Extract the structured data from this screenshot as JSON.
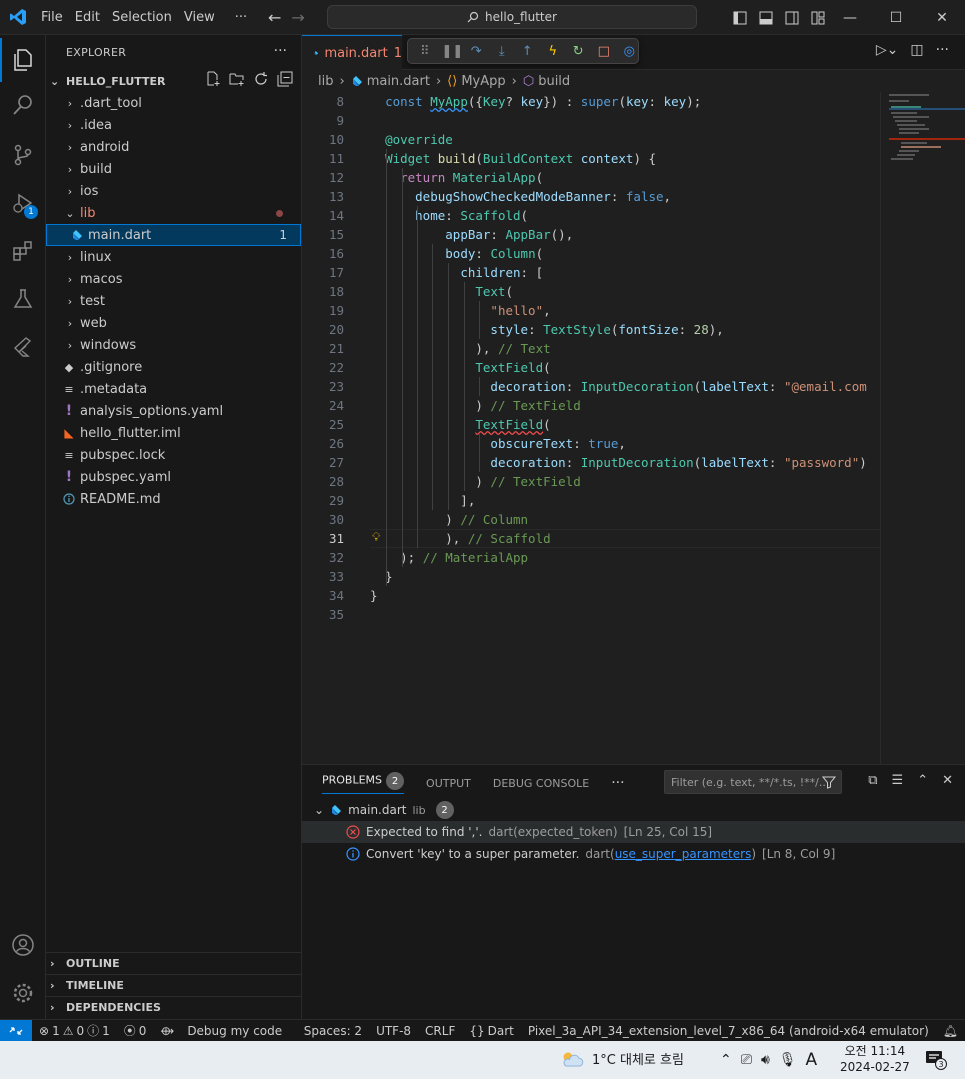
{
  "menu": [
    "File",
    "Edit",
    "Selection",
    "View",
    "···"
  ],
  "search": {
    "text": "hello_flutter"
  },
  "window_controls": [
    "minimize",
    "maximize",
    "close"
  ],
  "activity_bar": {
    "items": [
      "explorer-icon",
      "search-icon",
      "source-control-icon",
      "run-debug-icon",
      "extensions-icon",
      "testing-icon",
      "flutter-icon"
    ],
    "debug_badge": "1",
    "bottom": [
      "account-icon",
      "manage-gear-icon"
    ]
  },
  "explorer": {
    "title": "EXPLORER",
    "more": "···",
    "project": "HELLO_FLUTTER",
    "items": [
      {
        "label": ".dart_tool",
        "type": "folder"
      },
      {
        "label": ".idea",
        "type": "folder"
      },
      {
        "label": "android",
        "type": "folder"
      },
      {
        "label": "build",
        "type": "folder"
      },
      {
        "label": "ios",
        "type": "folder"
      },
      {
        "label": "lib",
        "type": "folder-open"
      },
      {
        "label": "main.dart",
        "type": "dart",
        "count": "1"
      },
      {
        "label": "linux",
        "type": "folder"
      },
      {
        "label": "macos",
        "type": "folder"
      },
      {
        "label": "test",
        "type": "folder"
      },
      {
        "label": "web",
        "type": "folder"
      },
      {
        "label": "windows",
        "type": "folder"
      },
      {
        "label": ".gitignore",
        "type": "file"
      },
      {
        "label": ".metadata",
        "type": "file"
      },
      {
        "label": "analysis_options.yaml",
        "type": "yaml"
      },
      {
        "label": "hello_flutter.iml",
        "type": "iml"
      },
      {
        "label": "pubspec.lock",
        "type": "lock"
      },
      {
        "label": "pubspec.yaml",
        "type": "yaml"
      },
      {
        "label": "README.md",
        "type": "info"
      }
    ],
    "sections": [
      "OUTLINE",
      "TIMELINE",
      "DEPENDENCIES"
    ]
  },
  "editor": {
    "tab": {
      "label": "main.dart",
      "count": "1"
    },
    "breadcrumb": [
      "lib",
      "main.dart",
      "MyApp",
      "build"
    ],
    "current_line": 31,
    "lines": [
      {
        "n": "8",
        "code": "  const MyApp({Key? key}) : super(key: key);"
      },
      {
        "n": "9",
        "code": ""
      },
      {
        "n": "10",
        "code": "  @override"
      },
      {
        "n": "11",
        "code": "  Widget build(BuildContext context) {"
      },
      {
        "n": "12",
        "code": "    return MaterialApp("
      },
      {
        "n": "13",
        "code": "      debugShowCheckedModeBanner: false,"
      },
      {
        "n": "14",
        "code": "      home: Scaffold("
      },
      {
        "n": "15",
        "code": "          appBar: AppBar(),"
      },
      {
        "n": "16",
        "code": "          body: Column("
      },
      {
        "n": "17",
        "code": "            children: ["
      },
      {
        "n": "18",
        "code": "              Text("
      },
      {
        "n": "19",
        "code": "                \"hello\","
      },
      {
        "n": "20",
        "code": "                style: TextStyle(fontSize: 28),"
      },
      {
        "n": "21",
        "code": "              ), // Text"
      },
      {
        "n": "22",
        "code": "              TextField("
      },
      {
        "n": "23",
        "code": "                decoration: InputDecoration(labelText: \"@email.com"
      },
      {
        "n": "24",
        "code": "              ) // TextField"
      },
      {
        "n": "25",
        "code": "              TextField("
      },
      {
        "n": "26",
        "code": "                obscureText: true,"
      },
      {
        "n": "27",
        "code": "                decoration: InputDecoration(labelText: \"password\")"
      },
      {
        "n": "28",
        "code": "              ) // TextField"
      },
      {
        "n": "29",
        "code": "            ],"
      },
      {
        "n": "30",
        "code": "          ) // Column"
      },
      {
        "n": "31",
        "code": "          ), // Scaffold"
      },
      {
        "n": "32",
        "code": "    ); // MaterialApp"
      },
      {
        "n": "33",
        "code": "  }"
      },
      {
        "n": "34",
        "code": "}"
      },
      {
        "n": "35",
        "code": ""
      }
    ]
  },
  "panel": {
    "tabs": [
      "PROBLEMS",
      "OUTPUT",
      "DEBUG CONSOLE",
      "···"
    ],
    "problems_count": "2",
    "filter_placeholder": "Filter (e.g. text, **/*.ts, !**/...",
    "file": {
      "name": "main.dart",
      "dir": "lib",
      "count": "2"
    },
    "problems": [
      {
        "severity": "error",
        "message": "Expected to find ','.",
        "source": "dart(expected_token)",
        "location": "[Ln 25, Col 15]"
      },
      {
        "severity": "info",
        "message": "Convert 'key' to a super parameter.",
        "source_prefix": "dart(",
        "source_link": "use_super_parameters",
        "source_suffix": ")",
        "location": "[Ln 8, Col 9]"
      }
    ]
  },
  "statusbar": {
    "errors": "1",
    "warnings": "0",
    "infos": "1",
    "ports": "0",
    "debug": "Debug my code",
    "spaces": "Spaces: 2",
    "encoding": "UTF-8",
    "eol": "CRLF",
    "language": "Dart",
    "device": "Pixel_3a_API_34_extension_level_7_x86_64 (android-x64 emulator)"
  },
  "taskbar": {
    "weather": "1°C  대체로 흐림",
    "ime": "A",
    "time": "오전 11:14",
    "date": "2024-02-27",
    "notifications": "3"
  },
  "colors": {
    "accent": "#0078d4",
    "error": "#f14c4c",
    "info": "#3794ff"
  }
}
